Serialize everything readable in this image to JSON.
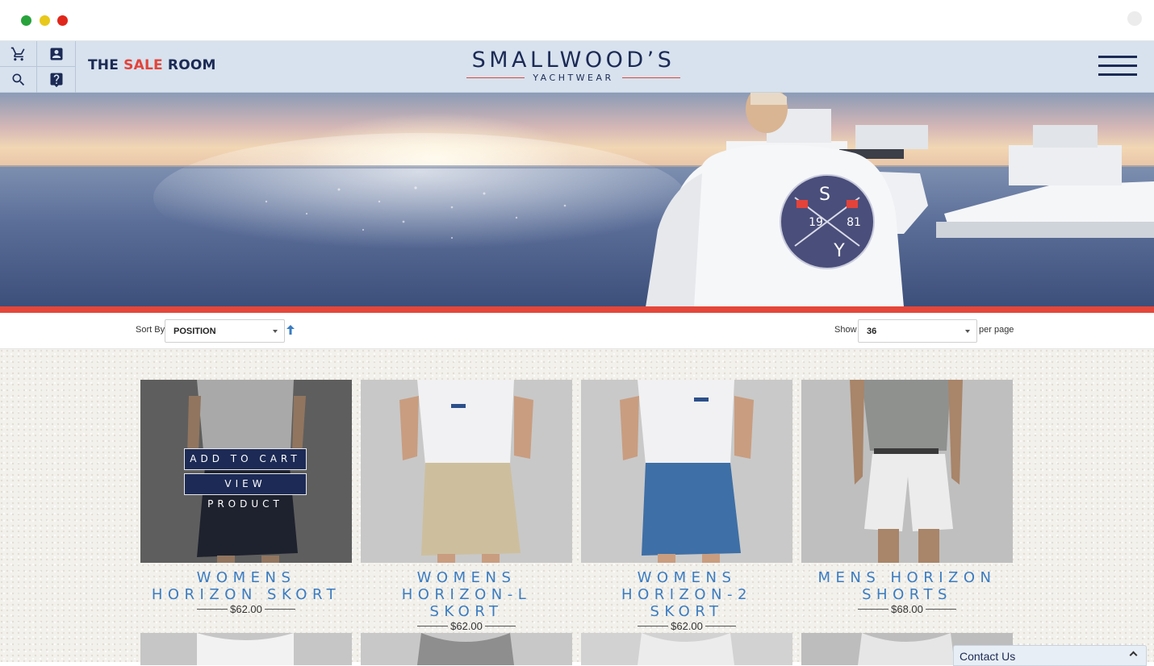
{
  "window": {
    "controls": [
      "close",
      "minimize",
      "maximize"
    ]
  },
  "header": {
    "icons": [
      "cart-icon",
      "account-icon",
      "search-icon",
      "help-icon"
    ],
    "title_prefix": "THE ",
    "title_accent": "SALE",
    "title_suffix": " ROOM",
    "logo_main": "SMALLWOOD’S",
    "logo_sub": "YACHTWEAR",
    "menu_icon": "hamburger-icon"
  },
  "hero": {
    "emblem_top": "S",
    "emblem_left": "19",
    "emblem_right": "81",
    "emblem_bottom": "Y"
  },
  "toolbar": {
    "sort_label": "Sort By",
    "sort_value": "POSITION",
    "sort_direction_icon": "arrow-up-icon",
    "show_label": "Show",
    "show_value": "36",
    "per_page_label": "per page"
  },
  "products": [
    {
      "name": "WOMENS HORIZON SKORT",
      "price": "$62.00",
      "skirt_color": "#202634",
      "top_color": "#d9d9d9",
      "bg_color": "#707070"
    },
    {
      "name": "WOMENS HORIZON-L SKORT",
      "price": "$62.00",
      "skirt_color": "#cdbf9e",
      "top_color": "#f1f1f3",
      "bg_color": "#c8c8c8"
    },
    {
      "name": "WOMENS HORIZON-2 SKORT",
      "price": "$62.00",
      "skirt_color": "#3e6fa6",
      "top_color": "#f1f1f3",
      "bg_color": "#c9c9c9"
    },
    {
      "name": "MENS HORIZON SHORTS",
      "price": "$68.00",
      "skirt_color": "#ececec",
      "top_color": "#8f918f",
      "bg_color": "#bfbfbf"
    }
  ],
  "hover_actions": {
    "add_to_cart": "ADD TO CART",
    "view_product": "VIEW PRODUCT"
  },
  "contact": {
    "label": "Contact Us"
  },
  "colors": {
    "navy": "#1c2a55",
    "accent_red": "#e4433a",
    "product_blue": "#3a7cc2",
    "header_bg": "#d7e2ee"
  }
}
